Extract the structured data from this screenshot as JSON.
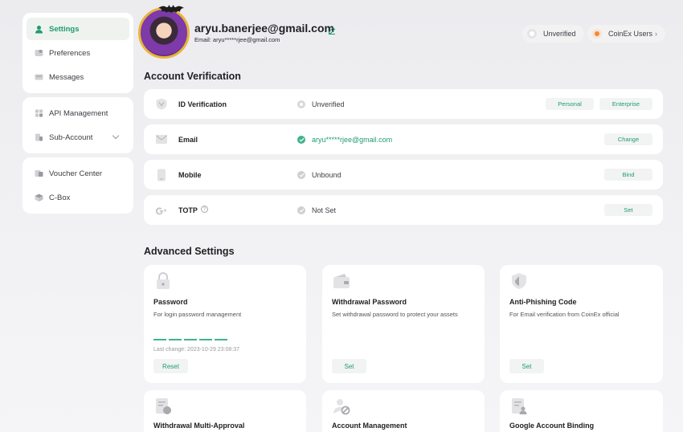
{
  "sidebar": {
    "groups": [
      [
        {
          "label": "Settings",
          "icon": "user-icon",
          "active": true
        },
        {
          "label": "Preferences",
          "icon": "preferences-icon"
        },
        {
          "label": "Messages",
          "icon": "message-icon"
        }
      ],
      [
        {
          "label": "API Management",
          "icon": "api-icon"
        },
        {
          "label": "Sub-Account",
          "icon": "sub-account-icon",
          "expandable": true
        }
      ],
      [
        {
          "label": "Voucher Center",
          "icon": "voucher-icon"
        },
        {
          "label": "C-Box",
          "icon": "cbox-icon"
        }
      ]
    ]
  },
  "profile": {
    "name": "aryu.banerjee@gmail.com",
    "email_label": "Email: aryu*****rjee@gmail.com"
  },
  "chips": {
    "unverified": "Unverified",
    "coinex_users": "CoinEx Users"
  },
  "account_verification": {
    "title": "Account Verification",
    "rows": [
      {
        "label": "ID Verification",
        "status": "Unverified",
        "buttons": [
          "Personal",
          "Enterprise"
        ],
        "icon": "id-icon"
      },
      {
        "label": "Email",
        "status": "aryu*****rjee@gmail.com",
        "buttons": [
          "Change"
        ],
        "icon": "email-icon"
      },
      {
        "label": "Mobile",
        "status": "Unbound",
        "buttons": [
          "Bind"
        ],
        "icon": "mobile-icon"
      },
      {
        "label": "TOTP",
        "status": "Not Set",
        "buttons": [
          "Set"
        ],
        "icon": "google-authenticator-icon"
      }
    ]
  },
  "advanced_settings": {
    "title": "Advanced Settings",
    "cards": [
      {
        "title": "Password",
        "desc": "For login password management",
        "button": "Reset",
        "last_change": "Last change: 2023-10-29 23:08:37",
        "icon": "lock-icon"
      },
      {
        "title": "Withdrawal Password",
        "desc": "Set withdrawal password to protect your assets",
        "button": "Set",
        "icon": "wallet-icon"
      },
      {
        "title": "Anti-Phishing Code",
        "desc": "For Email verification from CoinEx official",
        "button": "Set",
        "icon": "shield-icon"
      },
      {
        "title": "Withdrawal Multi-Approval",
        "icon": "multi-approval-icon"
      },
      {
        "title": "Account Management",
        "icon": "account-management-icon"
      },
      {
        "title": "Google Account Binding",
        "icon": "google-binding-icon"
      }
    ]
  },
  "colors": {
    "accent": "#1f9a73",
    "background": "#efeff1"
  }
}
